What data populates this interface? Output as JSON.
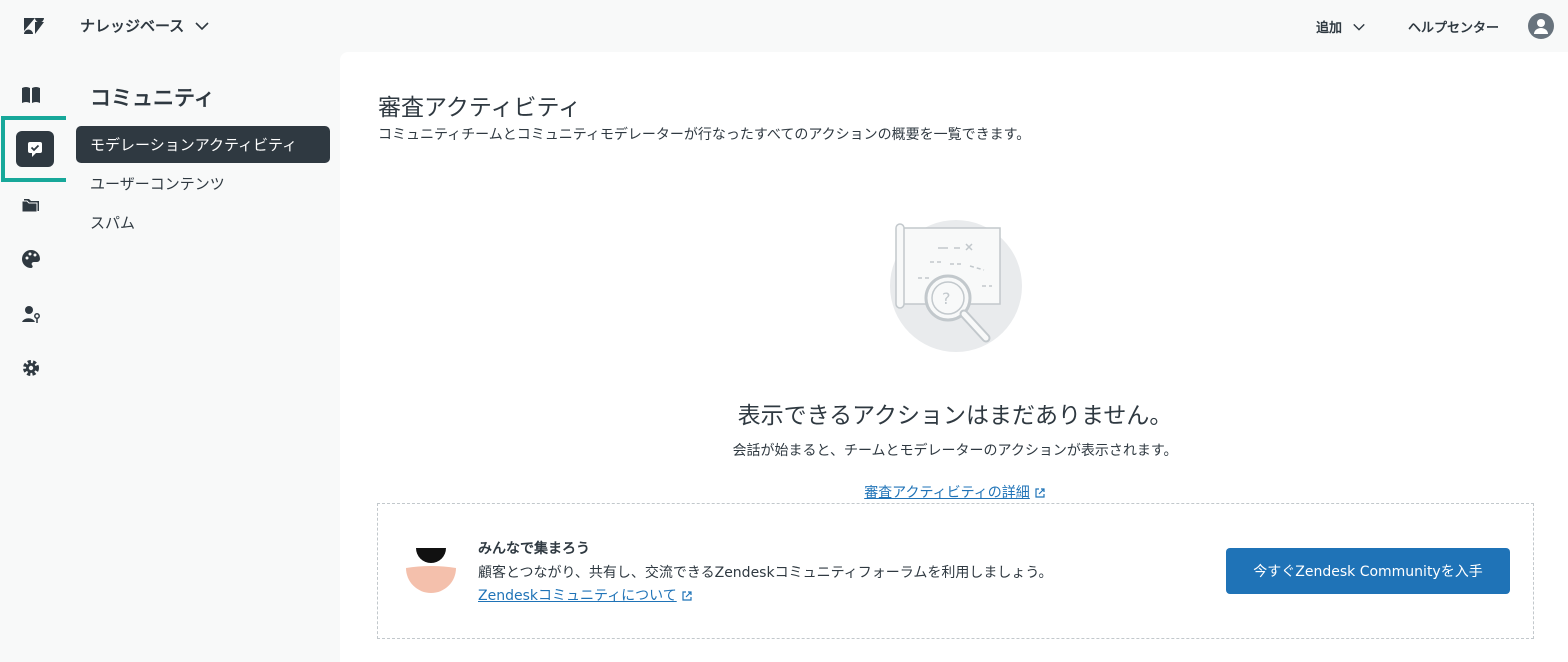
{
  "topbar": {
    "product_name": "ナレッジベース",
    "add_label": "追加",
    "help_center_label": "ヘルプセンター"
  },
  "rail": {
    "icons": [
      "book-icon",
      "moderation-icon",
      "folder-icon",
      "palette-icon",
      "user-permissions-icon",
      "gear-icon"
    ],
    "highlight_color": "#17a89a"
  },
  "subnav": {
    "title": "コミュニティ",
    "items": [
      {
        "label": "モデレーションアクティビティ",
        "active": true
      },
      {
        "label": "ユーザーコンテンツ",
        "active": false
      },
      {
        "label": "スパム",
        "active": false
      }
    ]
  },
  "main": {
    "title": "審査アクティビティ",
    "description": "コミュニティチームとコミュニティモデレーターが行なったすべてのアクションの概要を一覧できます。",
    "empty_state": {
      "title": "表示できるアクションはまだありません。",
      "subtitle": "会話が始まると、チームとモデレーターのアクションが表示されます。",
      "link_label": "審査アクティビティの詳細"
    },
    "promo": {
      "title": "みんなで集まろう",
      "text": "顧客とつながり、共有し、交流できるZendeskコミュニティフォーラムを利用しましょう。",
      "link_label": "Zendeskコミュニティについて",
      "button_label": "今すぐZendesk Communityを入手"
    }
  },
  "colors": {
    "accent": "#1f73b7",
    "dark": "#2f3941",
    "background": "#f8f9f9"
  }
}
